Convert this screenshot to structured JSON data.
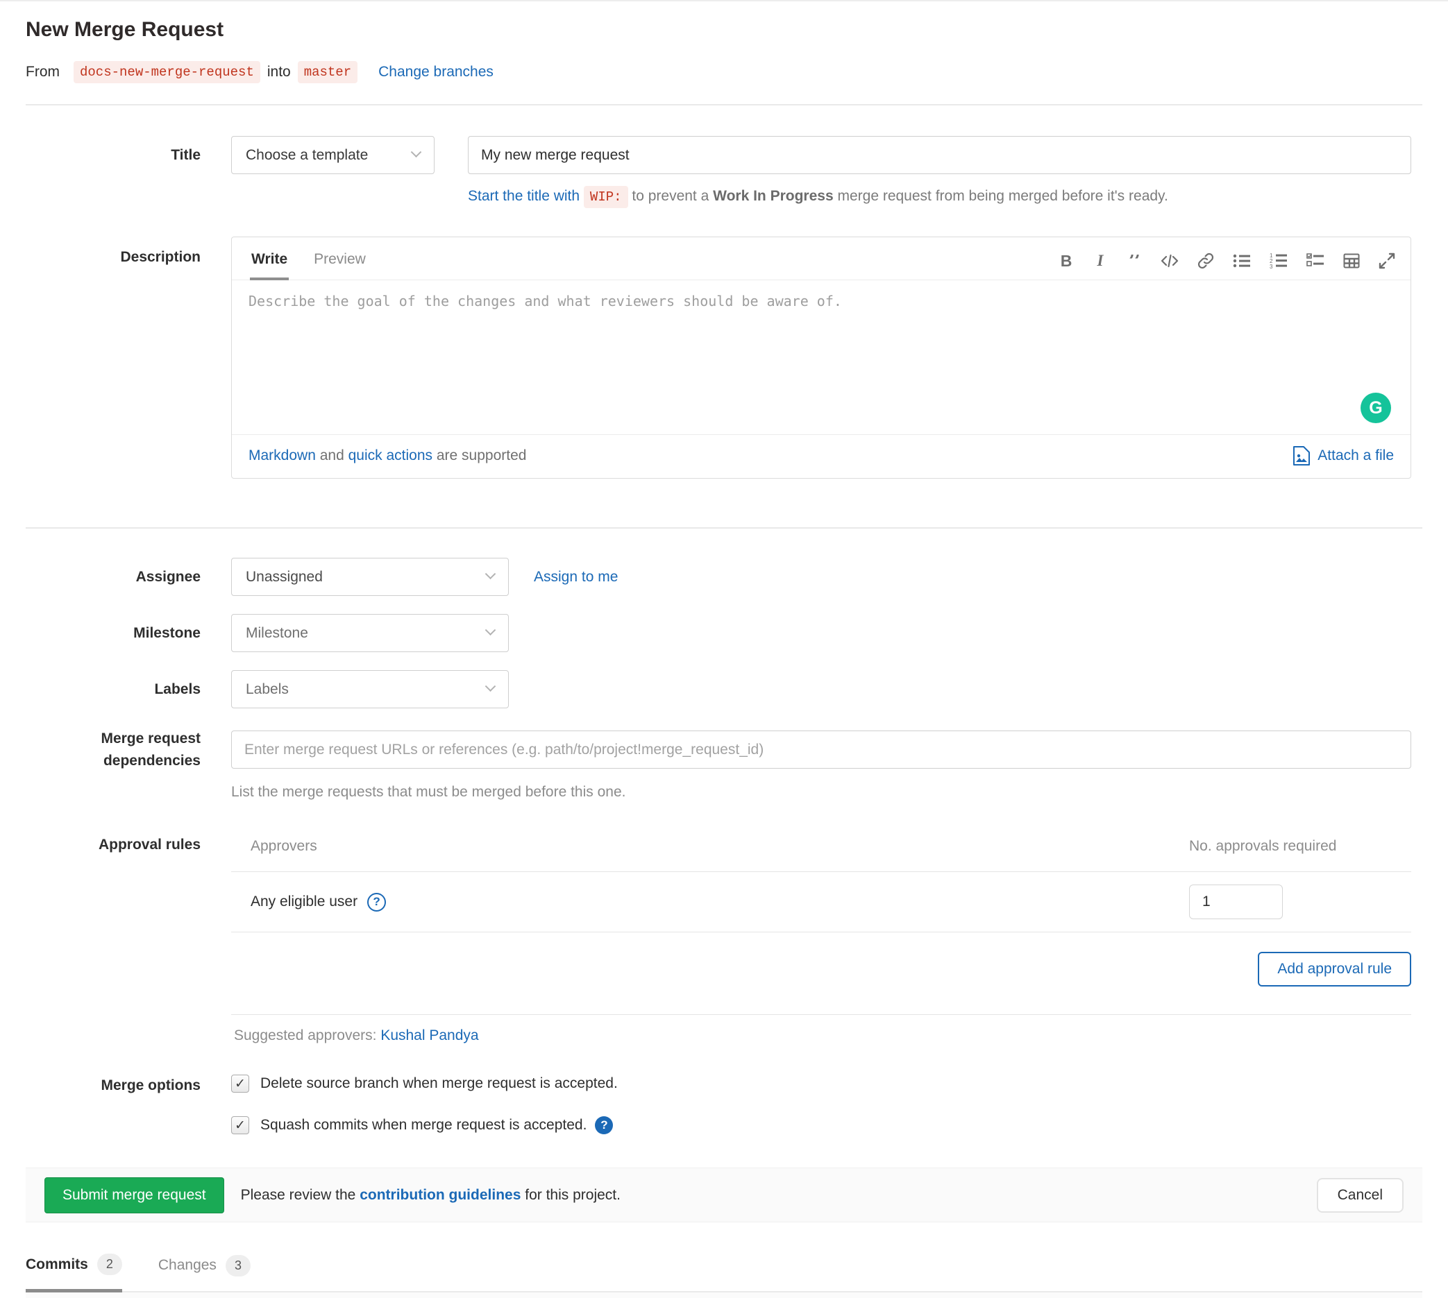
{
  "header": {
    "title": "New Merge Request",
    "from_label": "From",
    "source_branch": "docs-new-merge-request",
    "into_label": "into",
    "target_branch": "master",
    "change_branches_link": "Change branches"
  },
  "title_row": {
    "label": "Title",
    "template_dropdown": "Choose a template",
    "value": "My new merge request",
    "hint_link": "Start the title with",
    "hint_code": "WIP:",
    "hint_mid": "to prevent a",
    "hint_bold": "Work In Progress",
    "hint_rest": "merge request from being merged before it's ready."
  },
  "description": {
    "label": "Description",
    "tabs": [
      {
        "label": "Write",
        "active": true
      },
      {
        "label": "Preview",
        "active": false
      }
    ],
    "toolbar_icons": [
      "bold-icon",
      "italic-icon",
      "quote-icon",
      "code-icon",
      "link-icon",
      "bulleted-list-icon",
      "numbered-list-icon",
      "task-list-icon",
      "table-icon",
      "fullscreen-icon"
    ],
    "placeholder": "Describe the goal of the changes and what reviewers should be aware of.",
    "footer": {
      "markdown_link": "Markdown",
      "and_text": "and",
      "quick_actions_link": "quick actions",
      "supported_text": "are supported",
      "attach_link": "Attach a file"
    },
    "grammarly_icon": "G"
  },
  "fields": {
    "assignee": {
      "label": "Assignee",
      "value": "Unassigned",
      "action_link": "Assign to me"
    },
    "milestone": {
      "label": "Milestone",
      "value": "Milestone"
    },
    "labels": {
      "label": "Labels",
      "value": "Labels"
    },
    "dependencies": {
      "label": "Merge request dependencies",
      "placeholder": "Enter merge request URLs or references (e.g. path/to/project!merge_request_id)",
      "help": "List the merge requests that must be merged before this one."
    }
  },
  "approval_rules": {
    "label": "Approval rules",
    "columns": {
      "approvers": "Approvers",
      "required": "No. approvals required"
    },
    "rows": [
      {
        "name": "Any eligible user",
        "required_value": "1"
      }
    ],
    "add_button": "Add approval rule",
    "suggested_label": "Suggested approvers:",
    "suggested_link": "Kushal Pandya"
  },
  "merge_options": {
    "label": "Merge options",
    "options": [
      {
        "label": "Delete source branch when merge request is accepted.",
        "checked": true
      },
      {
        "label": "Squash commits when merge request is accepted.",
        "checked": true
      }
    ],
    "check_glyph": "✓"
  },
  "footer": {
    "submit_button": "Submit merge request",
    "review_pre": "Please review the",
    "review_link": "contribution guidelines",
    "review_post": "for this project.",
    "cancel_button": "Cancel"
  },
  "bottom_tabs": [
    {
      "label": "Commits",
      "badge": "2",
      "active": true
    },
    {
      "label": "Changes",
      "badge": "3",
      "active": false
    }
  ],
  "colors": {
    "link_blue": "#1b69b6",
    "button_green": "#1aaa55",
    "code_red": "#c0341d",
    "code_bg": "#fbece9",
    "grammarly_green": "#15c39a"
  }
}
